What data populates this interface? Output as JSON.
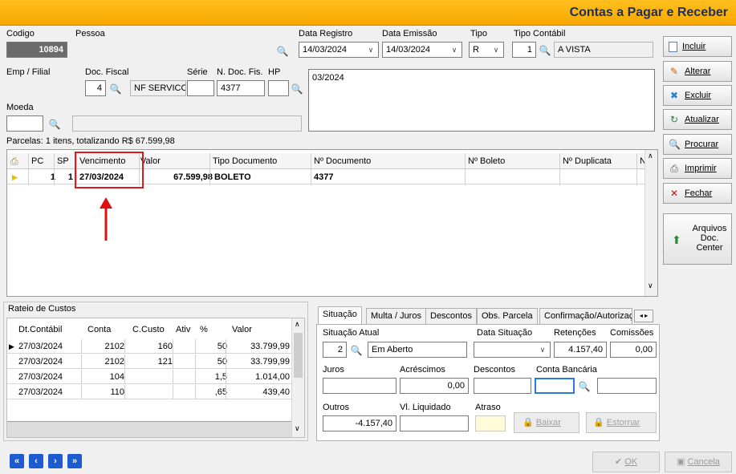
{
  "window": {
    "title": "Contas a Pagar e Receber"
  },
  "header": {
    "codigo_label": "Codigo",
    "codigo_value": "10894",
    "pessoa_label": "Pessoa",
    "pessoa_value": "",
    "data_registro_label": "Data Registro",
    "data_registro_value": "14/03/2024",
    "data_emissao_label": "Data Emissão",
    "data_emissao_value": "14/03/2024",
    "tipo_label": "Tipo",
    "tipo_value": "R",
    "tipo_contabil_label": "Tipo Contábil",
    "tipo_contabil_code": "1",
    "tipo_contabil_desc": "A VISTA",
    "emp_filial_label": "Emp / Filial",
    "emp_filial_value": "",
    "doc_fiscal_label": "Doc. Fiscal",
    "doc_fiscal_code": "4",
    "doc_fiscal_desc": "NF SERVICO",
    "serie_label": "Série",
    "serie_value": "",
    "n_doc_fis_label": "N. Doc. Fis.",
    "n_doc_fis_value": "4377",
    "hp_label": "HP",
    "hp_value": "",
    "observacao_value": "03/2024",
    "moeda_label": "Moeda",
    "moeda_value": "",
    "moeda_desc": ""
  },
  "sidebar": {
    "buttons": [
      {
        "label": "Incluir",
        "icon": "new-document-icon"
      },
      {
        "label": "Alterar",
        "icon": "pencil-icon"
      },
      {
        "label": "Excluir",
        "icon": "delete-icon"
      },
      {
        "label": "Atualizar",
        "icon": "refresh-icon"
      },
      {
        "label": "Procurar",
        "icon": "binoculars-icon"
      },
      {
        "label": "Imprimir",
        "icon": "printer-icon"
      },
      {
        "label": "Fechar",
        "icon": "close-window-icon"
      }
    ],
    "arquivos_line1": "Arquivos",
    "arquivos_line2": "Doc.",
    "arquivos_line3": "Center"
  },
  "parcelas": {
    "summary": "Parcelas: 1 itens, totalizando R$ 67.599,98",
    "columns": [
      "PC",
      "SP",
      "Vencimento",
      "Valor",
      "Tipo Documento",
      "Nº Documento",
      "Nº Boleto",
      "Nº Duplicata",
      "N"
    ],
    "rows": [
      {
        "pc": "1",
        "sp": "1",
        "vencimento": "27/03/2024",
        "valor": "67.599,98",
        "tipo_documento": "BOLETO",
        "n_documento": "4377",
        "n_boleto": "",
        "n_duplicata": ""
      }
    ]
  },
  "rateio": {
    "title": "Rateio de Custos",
    "columns": [
      "Dt.Contábil",
      "Conta",
      "C.Custo",
      "Ativ",
      "%",
      "Valor"
    ],
    "rows": [
      {
        "dt": "27/03/2024",
        "conta": "2102",
        "ccusto": "160",
        "ativ": "",
        "pct": "50",
        "valor": "33.799,99"
      },
      {
        "dt": "27/03/2024",
        "conta": "2102",
        "ccusto": "121",
        "ativ": "",
        "pct": "50",
        "valor": "33.799,99"
      },
      {
        "dt": "27/03/2024",
        "conta": "104",
        "ccusto": "",
        "ativ": "",
        "pct": "1,5",
        "valor": "1.014,00"
      },
      {
        "dt": "27/03/2024",
        "conta": "110",
        "ccusto": "",
        "ativ": "",
        "pct": ",65",
        "valor": "439,40"
      }
    ]
  },
  "tabs": [
    "Situação",
    "Multa / Juros",
    "Descontos",
    "Obs. Parcela",
    "Confirmação/Autorizaç"
  ],
  "situacao": {
    "situacao_atual_label": "Situação Atual",
    "situacao_code": "2",
    "situacao_desc": "Em Aberto",
    "data_situacao_label": "Data Situação",
    "data_situacao_value": "",
    "retencoes_label": "Retenções",
    "retencoes_value": "4.157,40",
    "comissoes_label": "Comissões",
    "comissoes_value": "0,00",
    "juros_label": "Juros",
    "juros_value": "",
    "acrescimos_label": "Acréscimos",
    "acrescimos_value": "0,00",
    "descontos_label": "Descontos",
    "descontos_value": "",
    "conta_bancaria_label": "Conta Bancária",
    "conta_bancaria_value": "",
    "conta_bancaria_desc": "",
    "outros_label": "Outros",
    "outros_value": "-4.157,40",
    "vl_liquidado_label": "Vl. Liquidado",
    "vl_liquidado_value": "",
    "atraso_label": "Atraso",
    "atraso_value": "",
    "baixar_label": "Baixar",
    "estornar_label": "Estornar"
  },
  "footer": {
    "ok_label": "OK",
    "cancela_label": "Cancela"
  },
  "colors": {
    "title_bar": "#f7a800",
    "highlight_box": "#d22020",
    "annotation_arrow": "#e01010"
  }
}
